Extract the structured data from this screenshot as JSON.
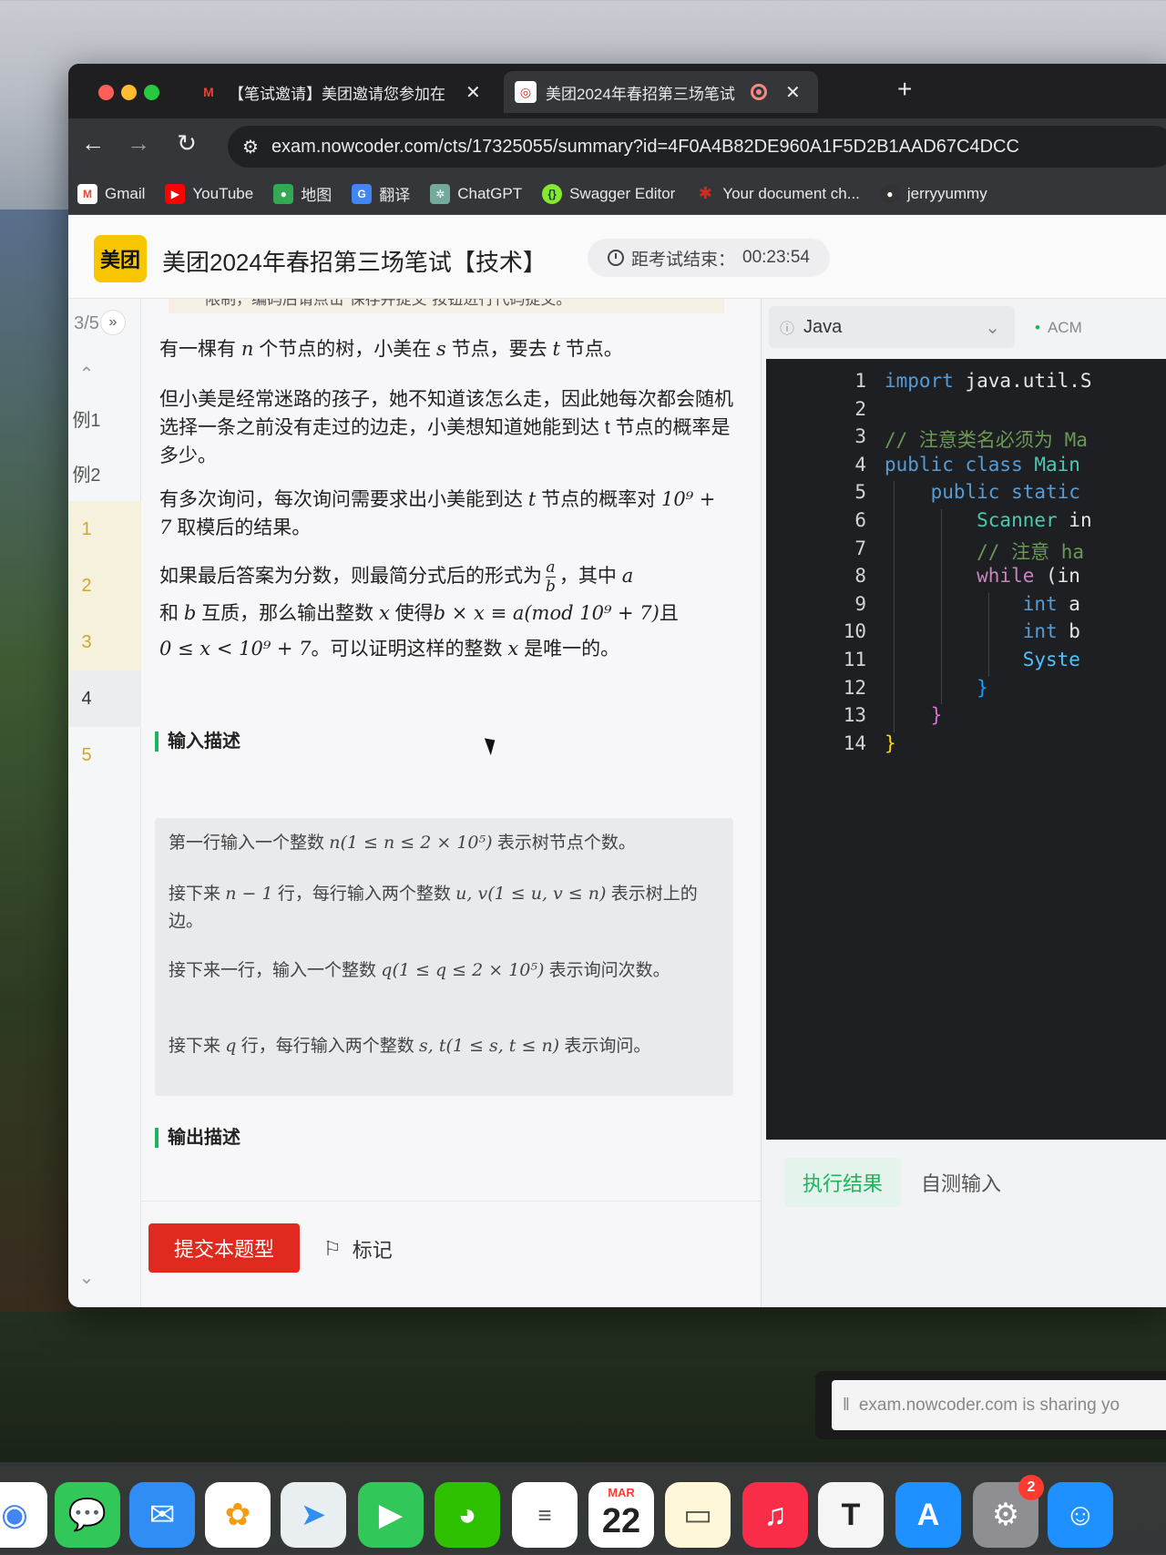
{
  "tabs": [
    {
      "label": "【笔试邀请】美团邀请您参加在",
      "icon": "gmail-icon",
      "active": false
    },
    {
      "label": "美团2024年春招第三场笔试",
      "icon": "nowcoder-icon",
      "active": true
    }
  ],
  "address_bar": {
    "url": "exam.nowcoder.com/cts/17325055/summary?id=4F0A4B82DE960A1F5D2B1AAD67C4DCC"
  },
  "bookmarks": [
    {
      "label": "Gmail",
      "icon": "gmail-icon",
      "color": "#ea4335"
    },
    {
      "label": "YouTube",
      "icon": "youtube-icon",
      "color": "#ff0000"
    },
    {
      "label": "地图",
      "icon": "maps-icon",
      "color": "#34a853"
    },
    {
      "label": "翻译",
      "icon": "translate-icon",
      "color": "#4285f4"
    },
    {
      "label": "ChatGPT",
      "icon": "chatgpt-icon",
      "color": "#74aa9c"
    },
    {
      "label": "Swagger Editor",
      "icon": "swagger-icon",
      "color": "#85ea2d"
    },
    {
      "label": "Your document ch...",
      "icon": "maple-leaf-icon",
      "color": "#d52b1e"
    },
    {
      "label": "jerryyummy",
      "icon": "github-icon",
      "color": "#333333"
    }
  ],
  "header": {
    "logo": "美团",
    "title": "美团2024年春招第三场笔试【技术】",
    "timer_label": "距考试结束：",
    "timer_value": "00:23:54"
  },
  "qnav": {
    "count": "3/5",
    "items": [
      "例1",
      "例2",
      "1",
      "2",
      "3",
      "4",
      "5"
    ]
  },
  "problem": {
    "cut_text": "限制，编码后请点击“保存并提交”按钮进行代码提交。",
    "p1_a": "有一棵有 ",
    "p1_n": "n",
    "p1_b": " 个节点的树，小美在 ",
    "p1_s": "s",
    "p1_c": " 节点，要去 ",
    "p1_t": "t",
    "p1_d": " 节点。",
    "p2": "但小美是经常迷路的孩子，她不知道该怎么走，因此她每次都会随机选择一条之前没有走过的边走，小美想知道她能到达 t 节点的概率是多少。",
    "p3_a": "有多次询问，每次询问需要求出小美能到达 ",
    "p3_t": "t",
    "p3_b": " 节点的概率对 ",
    "p3_m": "10⁹ + 7",
    "p3_c": " 取模后的结果。",
    "p4_a": "如果最后答案为分数，则最简分式后的形式为",
    "p4_num": "a",
    "p4_den": "b",
    "p4_b": "，其中 ",
    "p4_a2": "a",
    "p4_c": "和 ",
    "p4_bb": "b",
    "p4_d": " 互质，那么输出整数 ",
    "p4_x": "x",
    "p4_e": " 使得",
    "p4_eq": "b × x ≡ a(mod 10⁹ + 7)",
    "p4_f": "且",
    "p4_g": "0 ≤ x < 10⁹ + 7",
    "p4_h": "。可以证明这样的整数 ",
    "p4_x2": "x",
    "p4_i": " 是唯一的。",
    "input_title": "输入描述",
    "input_lines": [
      {
        "a": "第一行输入一个整数 ",
        "m": "n(1 ≤ n ≤ 2 × 10⁵)",
        "b": " 表示树节点个数。"
      },
      {
        "a": "接下来 ",
        "m": "n − 1",
        "b": " 行，每行输入两个整数 ",
        "m2": "u, v(1 ≤ u, v ≤ n)",
        "c": " 表示树上的边。"
      },
      {
        "a": "接下来一行，输入一个整数 ",
        "m": "q(1 ≤ q ≤ 2 × 10⁵)",
        "b": " 表示询问次数。"
      },
      {
        "a": "接下来 ",
        "m": "q",
        "b": " 行，每行输入两个整数 ",
        "m2": "s, t(1 ≤ s, t ≤ n)",
        "c": " 表示询问。"
      }
    ],
    "output_title": "输出描述"
  },
  "actions": {
    "submit": "提交本题型",
    "mark": "标记"
  },
  "editor": {
    "language": "Java",
    "mode": "ACM",
    "lines": [
      {
        "n": "1",
        "tokens": [
          {
            "t": "import",
            "c": "#569cd6"
          },
          {
            "t": " java.util.S",
            "c": "#e6e6e6"
          }
        ]
      },
      {
        "n": "2",
        "tokens": []
      },
      {
        "n": "3",
        "tokens": [
          {
            "t": "// 注意类名必须为 Ma",
            "c": "#6a9955"
          }
        ]
      },
      {
        "n": "4",
        "tokens": [
          {
            "t": "public class",
            "c": "#569cd6"
          },
          {
            "t": " Main",
            "c": "#4ec9b0"
          }
        ]
      },
      {
        "n": "5",
        "tokens": [
          {
            "t": "    public static",
            "c": "#569cd6"
          }
        ]
      },
      {
        "n": "6",
        "tokens": [
          {
            "t": "        Scanner",
            "c": "#4ec9b0"
          },
          {
            "t": " in",
            "c": "#e6e6e6"
          }
        ]
      },
      {
        "n": "7",
        "tokens": [
          {
            "t": "        // 注意 ha",
            "c": "#6a9955"
          }
        ]
      },
      {
        "n": "8",
        "tokens": [
          {
            "t": "        while",
            "c": "#c586c0"
          },
          {
            "t": " (in",
            "c": "#e6e6e6"
          }
        ]
      },
      {
        "n": "9",
        "tokens": [
          {
            "t": "            int",
            "c": "#569cd6"
          },
          {
            "t": " a",
            "c": "#e6e6e6"
          }
        ]
      },
      {
        "n": "10",
        "tokens": [
          {
            "t": "            int",
            "c": "#569cd6"
          },
          {
            "t": " b",
            "c": "#e6e6e6"
          }
        ]
      },
      {
        "n": "11",
        "tokens": [
          {
            "t": "            Syste",
            "c": "#4fc1ff"
          }
        ]
      },
      {
        "n": "12",
        "tokens": [
          {
            "t": "        }",
            "c": "#179fff"
          }
        ]
      },
      {
        "n": "13",
        "tokens": [
          {
            "t": "    }",
            "c": "#da70d6"
          }
        ]
      },
      {
        "n": "14",
        "tokens": [
          {
            "t": "}",
            "c": "#ffd700"
          }
        ]
      }
    ],
    "result_tabs": [
      "执行结果",
      "自测输入"
    ]
  },
  "share_bar": {
    "text": "exam.nowcoder.com is sharing yo"
  },
  "dock": {
    "calendar_month": "MAR",
    "calendar_day": "22",
    "settings_badge": "2"
  }
}
